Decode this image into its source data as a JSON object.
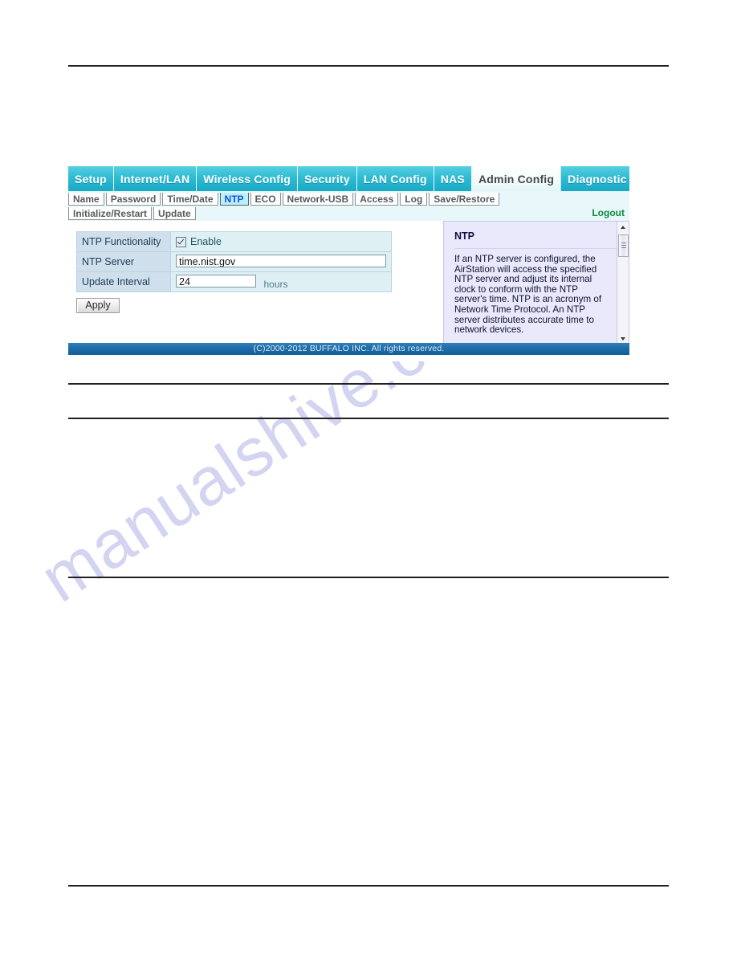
{
  "router_ui": {
    "main_tabs": [
      {
        "label": "Setup",
        "active": false
      },
      {
        "label": "Internet/LAN",
        "active": false
      },
      {
        "label": "Wireless Config",
        "active": false
      },
      {
        "label": "Security",
        "active": false
      },
      {
        "label": "LAN Config",
        "active": false
      },
      {
        "label": "NAS",
        "active": false
      },
      {
        "label": "Admin Config",
        "active": true
      },
      {
        "label": "Diagnostic",
        "active": false
      }
    ],
    "sub_tabs_row1": [
      {
        "label": "Name",
        "selected": false
      },
      {
        "label": "Password",
        "selected": false
      },
      {
        "label": "Time/Date",
        "selected": false
      },
      {
        "label": "NTP",
        "selected": true
      },
      {
        "label": "ECO",
        "selected": false
      },
      {
        "label": "Network-USB",
        "selected": false
      },
      {
        "label": "Access",
        "selected": false
      },
      {
        "label": "Log",
        "selected": false
      },
      {
        "label": "Save/Restore",
        "selected": false
      }
    ],
    "sub_tabs_row2": [
      {
        "label": "Initialize/Restart",
        "selected": false
      },
      {
        "label": "Update",
        "selected": false
      }
    ],
    "logout_label": "Logout",
    "settings": {
      "rows": [
        {
          "label": "NTP Functionality",
          "type": "checkbox",
          "checked": true,
          "checkbox_label": "Enable"
        },
        {
          "label": "NTP Server",
          "type": "text",
          "value": "time.nist.gov"
        },
        {
          "label": "Update Interval",
          "type": "text",
          "value": "24",
          "unit": "hours"
        }
      ]
    },
    "apply_label": "Apply",
    "help": {
      "title": "NTP",
      "text": "If an NTP server is configured, the AirStation will access the specified NTP server and adjust its internal clock to conform with the NTP server's time. NTP is an acronym of Network Time Protocol. An NTP server distributes accurate time to network devices."
    },
    "footer": "(C)2000-2012 BUFFALO INC. All rights reserved."
  },
  "page": {
    "watermark": "manualshive.com"
  },
  "colors": {
    "tab_accent": "#2fbcd4",
    "subtab_selected_bg": "#b8f0fb",
    "subtab_selected_text": "#1d4ed8",
    "logout_green": "#0b8a3e",
    "footer_blue": "#1d6ba6",
    "help_panel_bg": "#e9e9fb",
    "label_cell_bg": "#cfe0ec",
    "value_cell_bg": "#dff0f5"
  }
}
